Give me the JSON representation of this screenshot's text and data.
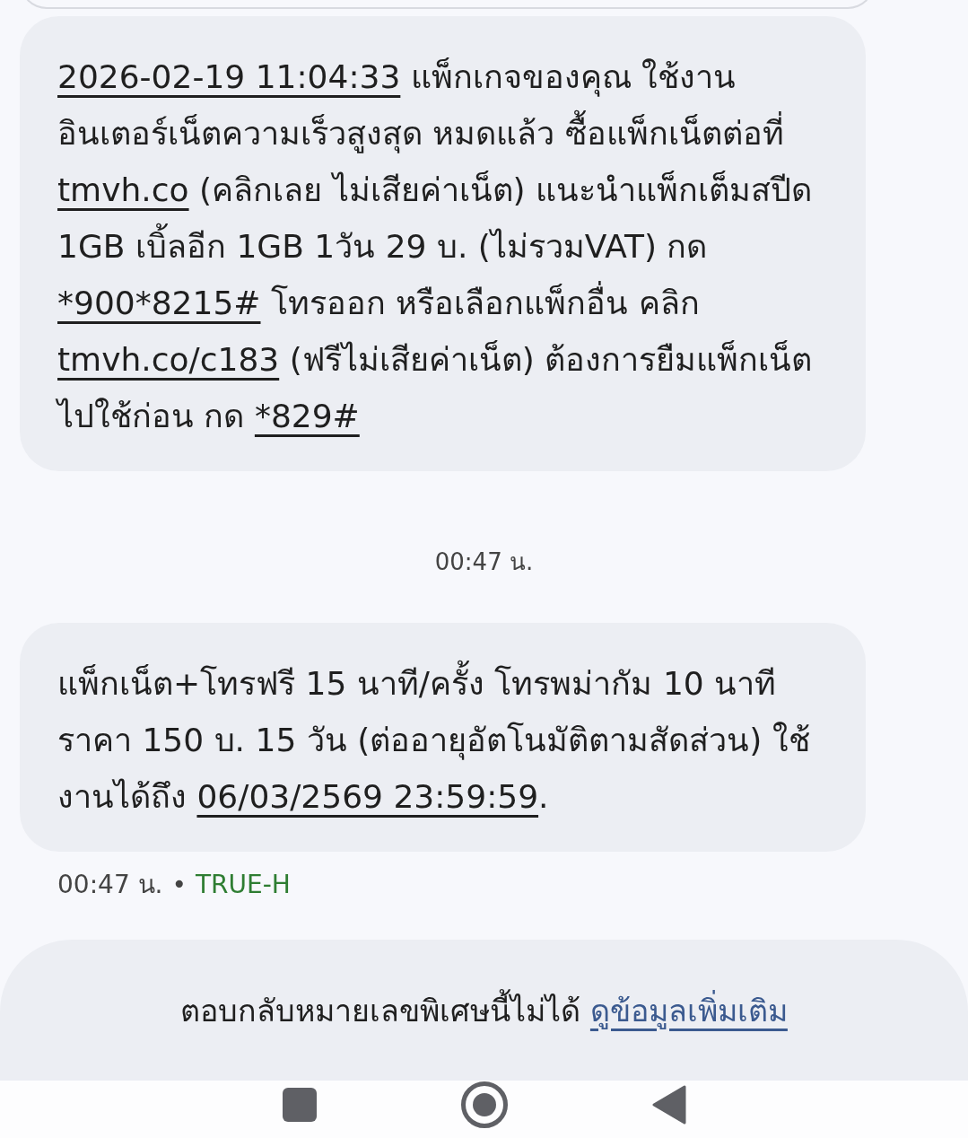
{
  "messages": [
    {
      "segments": [
        {
          "kind": "link",
          "text": "2026-02-19 11:04:33"
        },
        {
          "kind": "text",
          "text": " แพ็กเกจของคุณ ใช้งานอินเตอร์เน็ตความเร็วสูงสุด หมดแล้ว ซื้อแพ็กเน็ตต่อที่ "
        },
        {
          "kind": "link",
          "text": "tmvh.co"
        },
        {
          "kind": "text",
          "text": " (คลิกเลย ไม่เสียค่าเน็ต) แนะนำแพ็กเต็มสปีด 1GB เบิ้ลอีก 1GB 1วัน 29 บ. (ไม่รวมVAT) กด "
        },
        {
          "kind": "link",
          "text": "*900*8215#"
        },
        {
          "kind": "text",
          "text": " โทรออก หรือเลือกแพ็กอื่น คลิก "
        },
        {
          "kind": "link",
          "text": "tmvh.co/c183"
        },
        {
          "kind": "text",
          "text": " (ฟรีไม่เสียค่าเน็ต) ต้องการยืมแพ็กเน็ตไปใช้ก่อน กด "
        },
        {
          "kind": "link",
          "text": "*829#"
        }
      ]
    },
    {
      "time": "00:47 น.",
      "segments": [
        {
          "kind": "text",
          "text": "แพ็กเน็ต+โทรฟรี 15 นาที/ครั้ง โทรพม่ากัม 10 นาที ราคา 150 บ. 15 วัน (ต่ออายุอัตโนมัติตามสัดส่วน) ใช้งานได้ถึง "
        },
        {
          "kind": "link",
          "text": "06/03/2569 23:59:59"
        },
        {
          "kind": "text",
          "text": "."
        }
      ]
    }
  ],
  "meta": {
    "time": "00:47 น.",
    "separator": "•",
    "sender": "TRUE-H"
  },
  "reply_notice": {
    "text": "ตอบกลับหมายเลขพิเศษนี้ไม่ได้ ",
    "link": "ดูข้อมูลเพิ่มเติม"
  }
}
